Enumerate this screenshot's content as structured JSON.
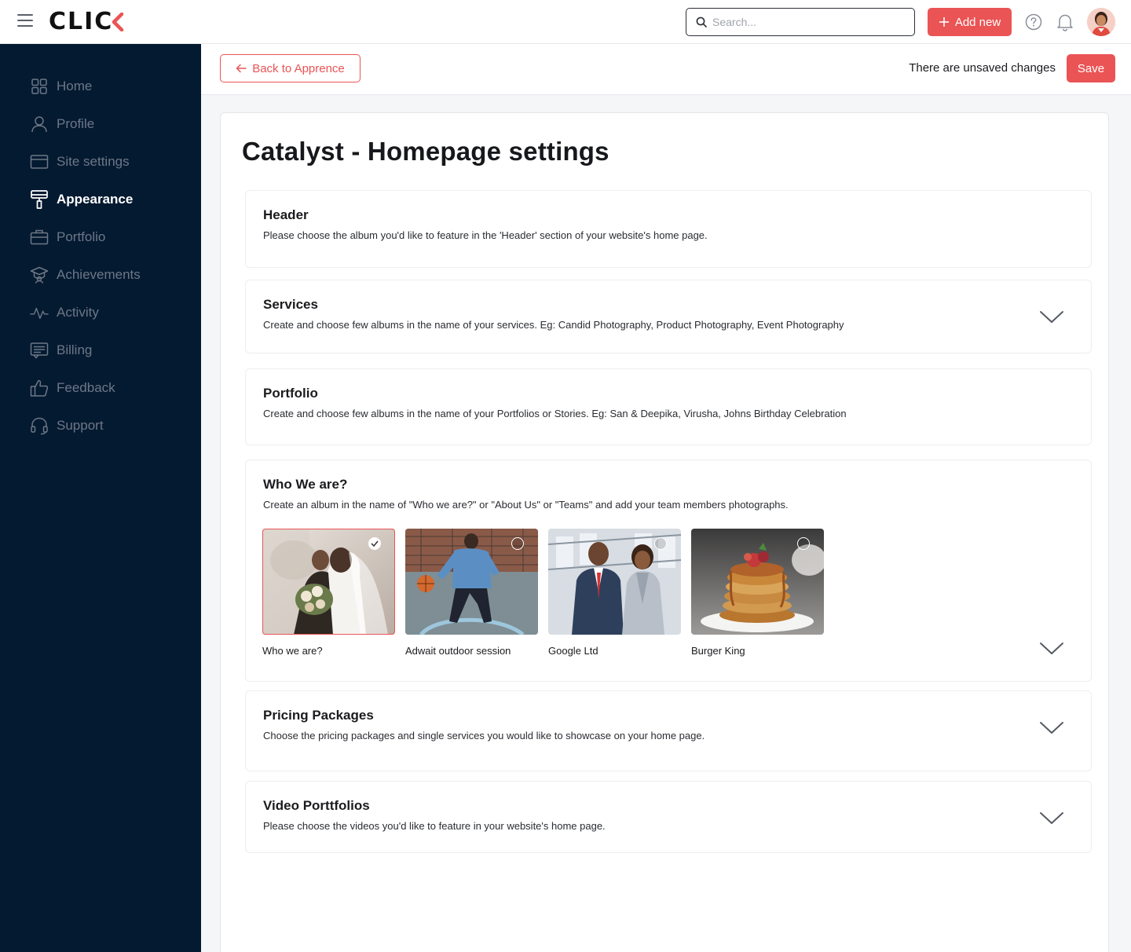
{
  "brand": {
    "logo_text": "CLIC",
    "accent_color": "#ea5455",
    "sidebar_bg": "#041a31"
  },
  "topbar": {
    "search_placeholder": "Search...",
    "add_new_label": "Add new"
  },
  "sidebar": {
    "items": [
      {
        "label": "Home",
        "icon": "grid-icon",
        "active": false
      },
      {
        "label": "Profile",
        "icon": "user-icon",
        "active": false
      },
      {
        "label": "Site settings",
        "icon": "browser-icon",
        "active": false
      },
      {
        "label": "Appearance",
        "icon": "paint-roller-icon",
        "active": true
      },
      {
        "label": "Portfolio",
        "icon": "briefcase-icon",
        "active": false
      },
      {
        "label": "Achievements",
        "icon": "graduation-cap-icon",
        "active": false
      },
      {
        "label": "Activity",
        "icon": "pulse-icon",
        "active": false
      },
      {
        "label": "Billing",
        "icon": "receipt-icon",
        "active": false
      },
      {
        "label": "Feedback",
        "icon": "thumbs-up-icon",
        "active": false
      },
      {
        "label": "Support",
        "icon": "headset-icon",
        "active": false
      }
    ]
  },
  "actionbar": {
    "back_label": "Back to Apprence",
    "unsaved_text": "There are unsaved changes",
    "save_label": "Save"
  },
  "page": {
    "title": "Catalyst - Homepage settings",
    "sections": [
      {
        "title": "Header",
        "description": "Please choose the album you'd like to feature in the 'Header' section of your website's home page."
      },
      {
        "title": "Services",
        "description": "Create and choose few albums in the name of your services. Eg: Candid Photography, Product Photography, Event Photography"
      },
      {
        "title": "Portfolio",
        "description": "Create and choose few albums in the name of your Portfolios or Stories. Eg: San & Deepika, Virusha, Johns Birthday Celebration"
      },
      {
        "title": "Who We are?",
        "description": "Create an album in the name of \"Who we are?\" or \"About Us\" or \"Teams\" and add your team members photographs."
      },
      {
        "title": "Pricing Packages",
        "description": "Choose the pricing packages and single services you would like to showcase on your home page."
      },
      {
        "title": "Video Porttfolios",
        "description": "Please choose the videos you'd like to feature in your website's home page."
      }
    ],
    "albums": [
      {
        "name": "Who we are?",
        "selected": true
      },
      {
        "name": "Adwait outdoor session",
        "selected": false
      },
      {
        "name": "Google Ltd",
        "selected": false
      },
      {
        "name": "Burger King",
        "selected": false
      }
    ]
  }
}
